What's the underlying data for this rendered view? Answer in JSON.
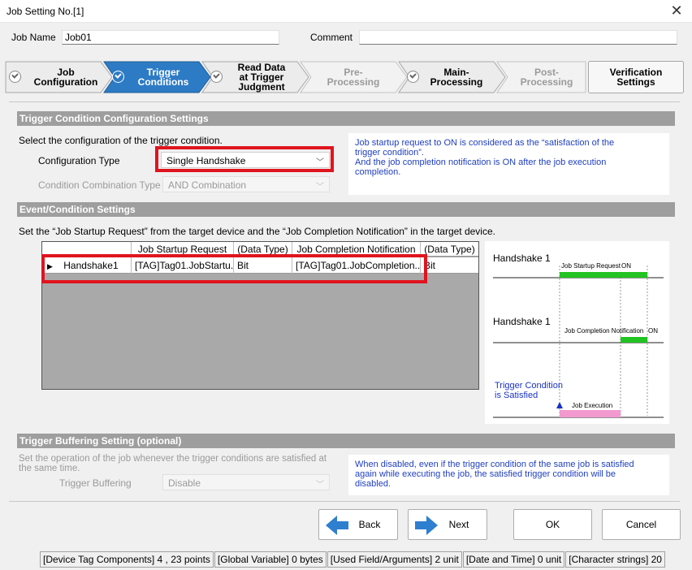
{
  "window": {
    "title": "Job Setting No.[1]"
  },
  "job": {
    "name_label": "Job Name",
    "name_value": "Job01",
    "comment_label": "Comment",
    "comment_value": ""
  },
  "steps": [
    {
      "l1": "Job",
      "l2": "Configuration",
      "l3": ""
    },
    {
      "l1": "Trigger",
      "l2": "Conditions",
      "l3": ""
    },
    {
      "l1": "Read Data",
      "l2": "at Trigger",
      "l3": "Judgment"
    },
    {
      "l1": "Pre-",
      "l2": "Processing",
      "l3": ""
    },
    {
      "l1": "Main-",
      "l2": "Processing",
      "l3": ""
    },
    {
      "l1": "Post-",
      "l2": "Processing",
      "l3": ""
    },
    {
      "l1": "Verification",
      "l2": "Settings",
      "l3": ""
    }
  ],
  "trigger_config": {
    "section_title": "Trigger Condition Configuration Settings",
    "prompt": "Select the configuration of the trigger condition.",
    "config_type_label": "Configuration Type",
    "config_type_value": "Single Handshake",
    "combination_label": "Condition Combination Type",
    "combination_value": "AND Combination",
    "info_line1": "Job startup request to ON is considered as the “satisfaction of the",
    "info_line2": "trigger condition”.",
    "info_line3": "And the job completion notification is ON after the job execution",
    "info_line4": "completion."
  },
  "event_settings": {
    "section_title": "Event/Condition Settings",
    "prompt": "Set the “Job Startup Request” from the target device and the “Job Completion Notification” in the target device.",
    "columns": [
      "",
      "Job Startup Request",
      "(Data Type)",
      "Job Completion Notification",
      "(Data Type)"
    ],
    "rows": [
      {
        "name": "Handshake1",
        "startup": "[TAG]Tag01.JobStartu...",
        "startup_type": "Bit",
        "completion": "[TAG]Tag01.JobCompletion...",
        "completion_type": "Bit"
      }
    ]
  },
  "timing": {
    "handshake1_top": "Handshake 1",
    "startup_label": "Job Startup Request",
    "startup_on": "ON",
    "handshake1_mid": "Handshake 1",
    "completion_label": "Job Completion Notification",
    "completion_on": "ON",
    "satisfied_line1": "Trigger Condition",
    "satisfied_line2": "is Satisfied",
    "execution_label": "Job Execution",
    "colors": {
      "on_bar": "#22c322",
      "exec_bar": "#f29ad0",
      "satisfied_text": "#1a32c8"
    }
  },
  "buffering": {
    "section_title": "Trigger Buffering Setting (optional)",
    "prompt_line1": "Set the operation of the job whenever the trigger conditions are satisfied at",
    "prompt_line2": "the same time.",
    "label": "Trigger Buffering",
    "value": "Disable",
    "info_line1": "When disabled, even if the trigger condition of the same job is satisfied",
    "info_line2": "again while executing the job, the satisfied trigger condition will be",
    "info_line3": "disabled."
  },
  "buttons": {
    "back": "Back",
    "next": "Next",
    "ok": "OK",
    "cancel": "Cancel"
  },
  "status": [
    "[Device Tag Components]  4  ,   23 points",
    "[Global Variable]   0 bytes",
    "[Used Field/Arguments]   2 unit",
    "[Date and Time]   0 unit",
    "[Character strings]   20"
  ],
  "colors": {
    "active_step": "#2d7bc4",
    "highlight": "#e0141e",
    "info_text": "#1f3fbf",
    "arrow_blue": "#2f7fd0"
  }
}
